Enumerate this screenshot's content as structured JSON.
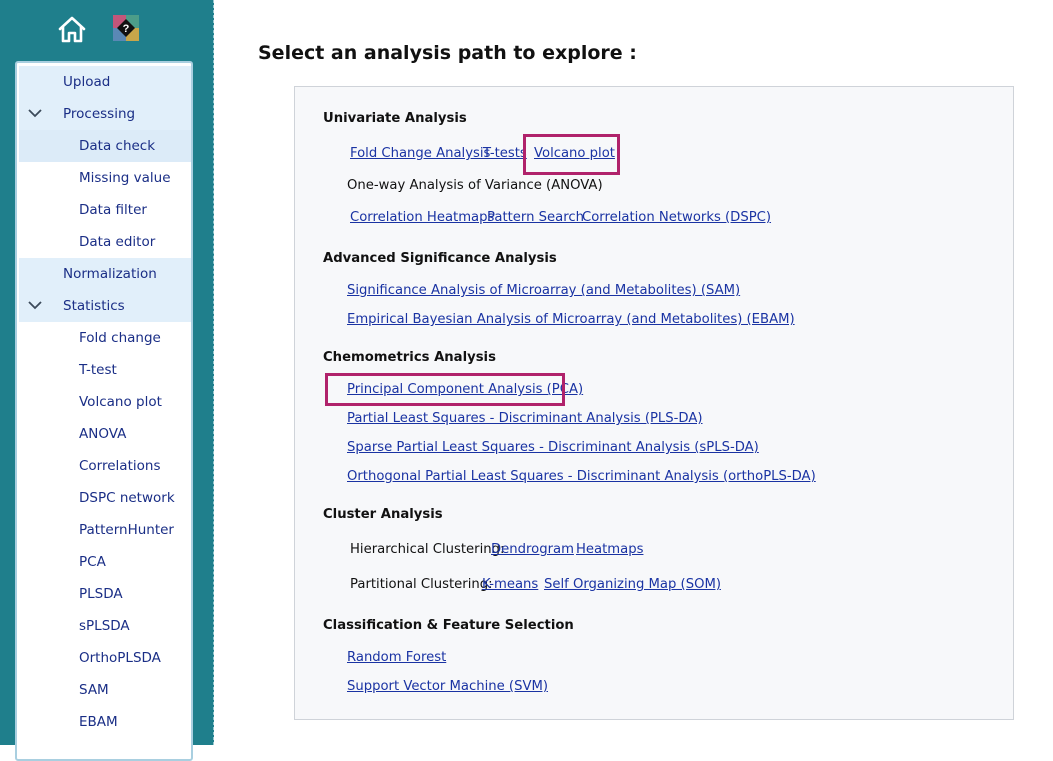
{
  "sidebar": {
    "home_icon": "home-icon",
    "help_icon": "help-question-icon",
    "menu": [
      {
        "label": "Upload",
        "level": "top"
      },
      {
        "label": "Processing",
        "level": "top",
        "expanded": true
      },
      {
        "label": "Data check",
        "level": "sub",
        "active": true
      },
      {
        "label": "Missing value",
        "level": "sub"
      },
      {
        "label": "Data filter",
        "level": "sub"
      },
      {
        "label": "Data editor",
        "level": "sub"
      },
      {
        "label": "Normalization",
        "level": "top"
      },
      {
        "label": "Statistics",
        "level": "top",
        "expanded": true
      },
      {
        "label": "Fold change",
        "level": "sub"
      },
      {
        "label": "T-test",
        "level": "sub"
      },
      {
        "label": "Volcano plot",
        "level": "sub"
      },
      {
        "label": "ANOVA",
        "level": "sub"
      },
      {
        "label": "Correlations",
        "level": "sub"
      },
      {
        "label": "DSPC network",
        "level": "sub"
      },
      {
        "label": "PatternHunter",
        "level": "sub"
      },
      {
        "label": "PCA",
        "level": "sub"
      },
      {
        "label": "PLSDA",
        "level": "sub"
      },
      {
        "label": "sPLSDA",
        "level": "sub"
      },
      {
        "label": "OrthoPLSDA",
        "level": "sub"
      },
      {
        "label": "SAM",
        "level": "sub"
      },
      {
        "label": "EBAM",
        "level": "sub"
      }
    ]
  },
  "main": {
    "title": "Select an analysis path to explore :",
    "univariate": {
      "title": "Univariate Analysis",
      "fold_change": "Fold Change Analysis",
      "ttests": "T-tests",
      "volcano": "Volcano plot",
      "anova": "One-way Analysis of Variance (ANOVA)",
      "corr_heatmaps": "Correlation Heatmaps",
      "pattern_search": "Pattern Search",
      "corr_networks": "Correlation Networks (DSPC)"
    },
    "advanced": {
      "title": "Advanced Significance Analysis",
      "sam": "Significance Analysis of Microarray (and Metabolites) (SAM)",
      "ebam": "Empirical Bayesian Analysis of Microarray (and Metabolites) (EBAM)"
    },
    "chemometrics": {
      "title": "Chemometrics Analysis",
      "pca": "Principal Component Analysis (PCA)",
      "plsda": "Partial Least Squares - Discriminant Analysis (PLS-DA)",
      "splsda": "Sparse Partial Least Squares - Discriminant Analysis (sPLS-DA)",
      "orthoplsda": "Orthogonal Partial Least Squares - Discriminant Analysis (orthoPLS-DA)"
    },
    "cluster": {
      "title": "Cluster Analysis",
      "hier_label": "Hierarchical Clustering:",
      "dendrogram": "Dendrogram",
      "heatmaps": "Heatmaps",
      "part_label": "Partitional Clustering:",
      "kmeans": "K-means",
      "som": "Self Organizing Map (SOM)"
    },
    "classification": {
      "title": "Classification & Feature Selection",
      "rf": "Random Forest",
      "svm": "Support Vector Machine (SVM)"
    }
  },
  "colors": {
    "sidebar_bg": "#1f7f8c",
    "link": "#1a33a3",
    "highlight": "#b0226b",
    "menu_text": "#1a2e86"
  }
}
